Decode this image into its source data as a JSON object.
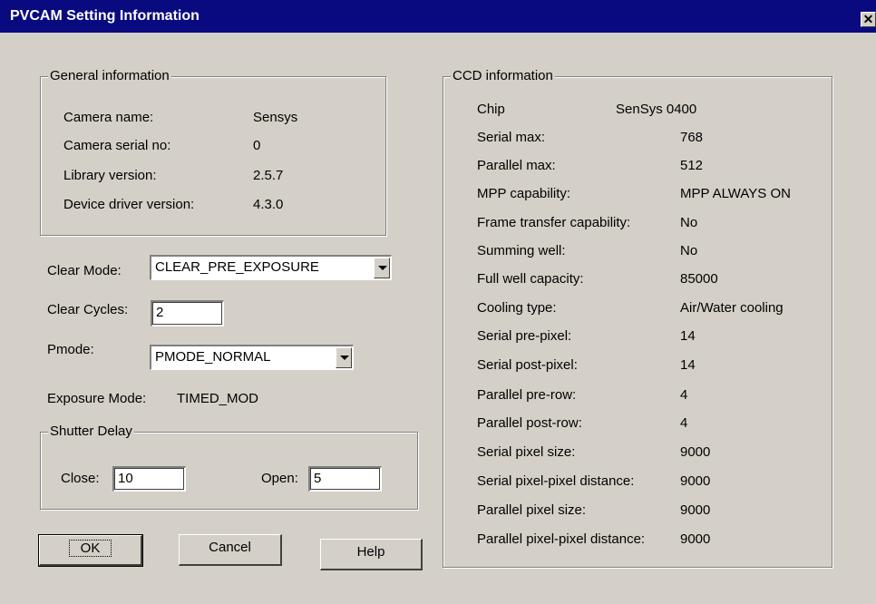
{
  "window": {
    "title": "PVCAM Setting Information",
    "close_symbol": "✕"
  },
  "general": {
    "legend": "General information",
    "rows": [
      {
        "label": "Camera name:",
        "value": "Sensys"
      },
      {
        "label": "Camera serial no:",
        "value": "0"
      },
      {
        "label": "Library version:",
        "value": "2.5.7"
      },
      {
        "label": "Device driver version:",
        "value": "4.3.0"
      }
    ]
  },
  "clear_mode": {
    "label": "Clear Mode:",
    "value": "CLEAR_PRE_EXPOSURE"
  },
  "clear_cycles": {
    "label": "Clear Cycles:",
    "value": "2"
  },
  "pmode": {
    "label": "Pmode:",
    "value": "PMODE_NORMAL"
  },
  "exposure_mode": {
    "label": "Exposure Mode:",
    "value": "TIMED_MOD"
  },
  "shutter": {
    "legend": "Shutter Delay",
    "close_label": "Close:",
    "close_value": "10",
    "open_label": "Open:",
    "open_value": "5"
  },
  "buttons": {
    "ok": "OK",
    "cancel": "Cancel",
    "help": "Help"
  },
  "ccd": {
    "legend": "CCD information",
    "chip_label": "Chip",
    "chip_value": "SenSys 0400",
    "rows": [
      {
        "label": "Serial max:",
        "value": "768"
      },
      {
        "label": "Parallel max:",
        "value": "512"
      },
      {
        "label": "MPP capability:",
        "value": "MPP ALWAYS ON"
      },
      {
        "label": "Frame transfer capability:",
        "value": "No"
      },
      {
        "label": "Summing well:",
        "value": "No"
      },
      {
        "label": "Full well capacity:",
        "value": "85000"
      },
      {
        "label": "Cooling type:",
        "value": "Air/Water cooling"
      },
      {
        "label": "Serial pre-pixel:",
        "value": "14"
      },
      {
        "label": "Serial post-pixel:",
        "value": "14"
      },
      {
        "label": "Parallel pre-row:",
        "value": "4"
      },
      {
        "label": "Parallel post-row:",
        "value": "4"
      },
      {
        "label": "Serial pixel size:",
        "value": "9000"
      },
      {
        "label": "Serial pixel-pixel distance:",
        "value": "9000"
      },
      {
        "label": "Parallel pixel size:",
        "value": "9000"
      },
      {
        "label": "Parallel pixel-pixel distance:",
        "value": "9000"
      }
    ]
  }
}
